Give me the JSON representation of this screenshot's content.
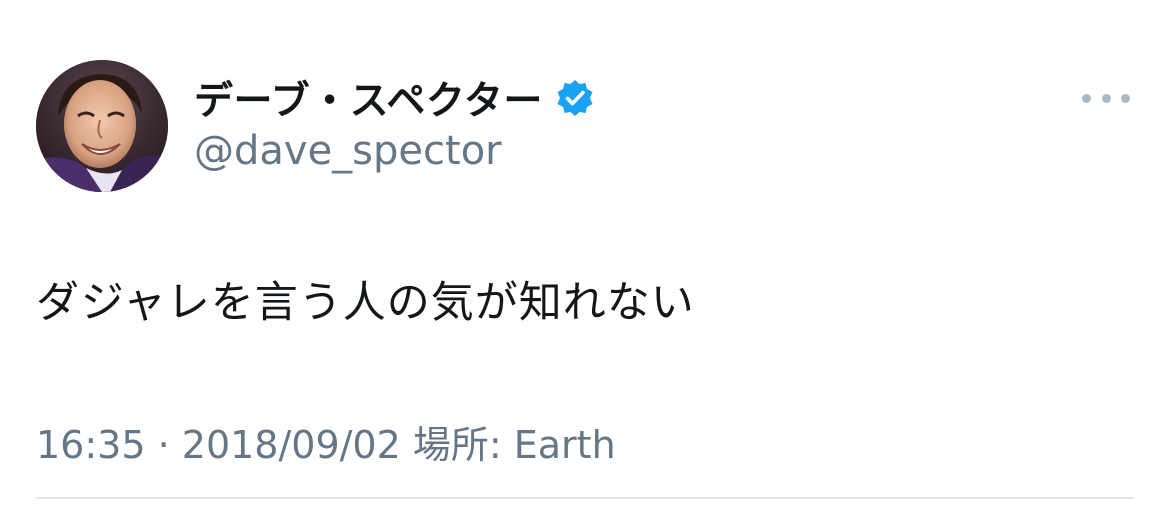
{
  "tweet": {
    "author": {
      "display_name": "デーブ・スペクター",
      "handle": "@dave_spector",
      "verified": true,
      "verified_icon": "verified-badge-icon",
      "avatar_icon": "avatar"
    },
    "text": "ダジャレを言う人の気が知れない",
    "meta": {
      "time": "16:35",
      "separator": " · ",
      "date": "2018/09/02",
      "location": " 場所: Earth"
    },
    "more_icon": "more-horizontal-icon"
  },
  "colors": {
    "text_primary": "#14171a",
    "text_secondary": "#657786",
    "verified_blue": "#1da1f2",
    "divider": "#e1e8ed",
    "more_icon": "#aab8c2"
  }
}
